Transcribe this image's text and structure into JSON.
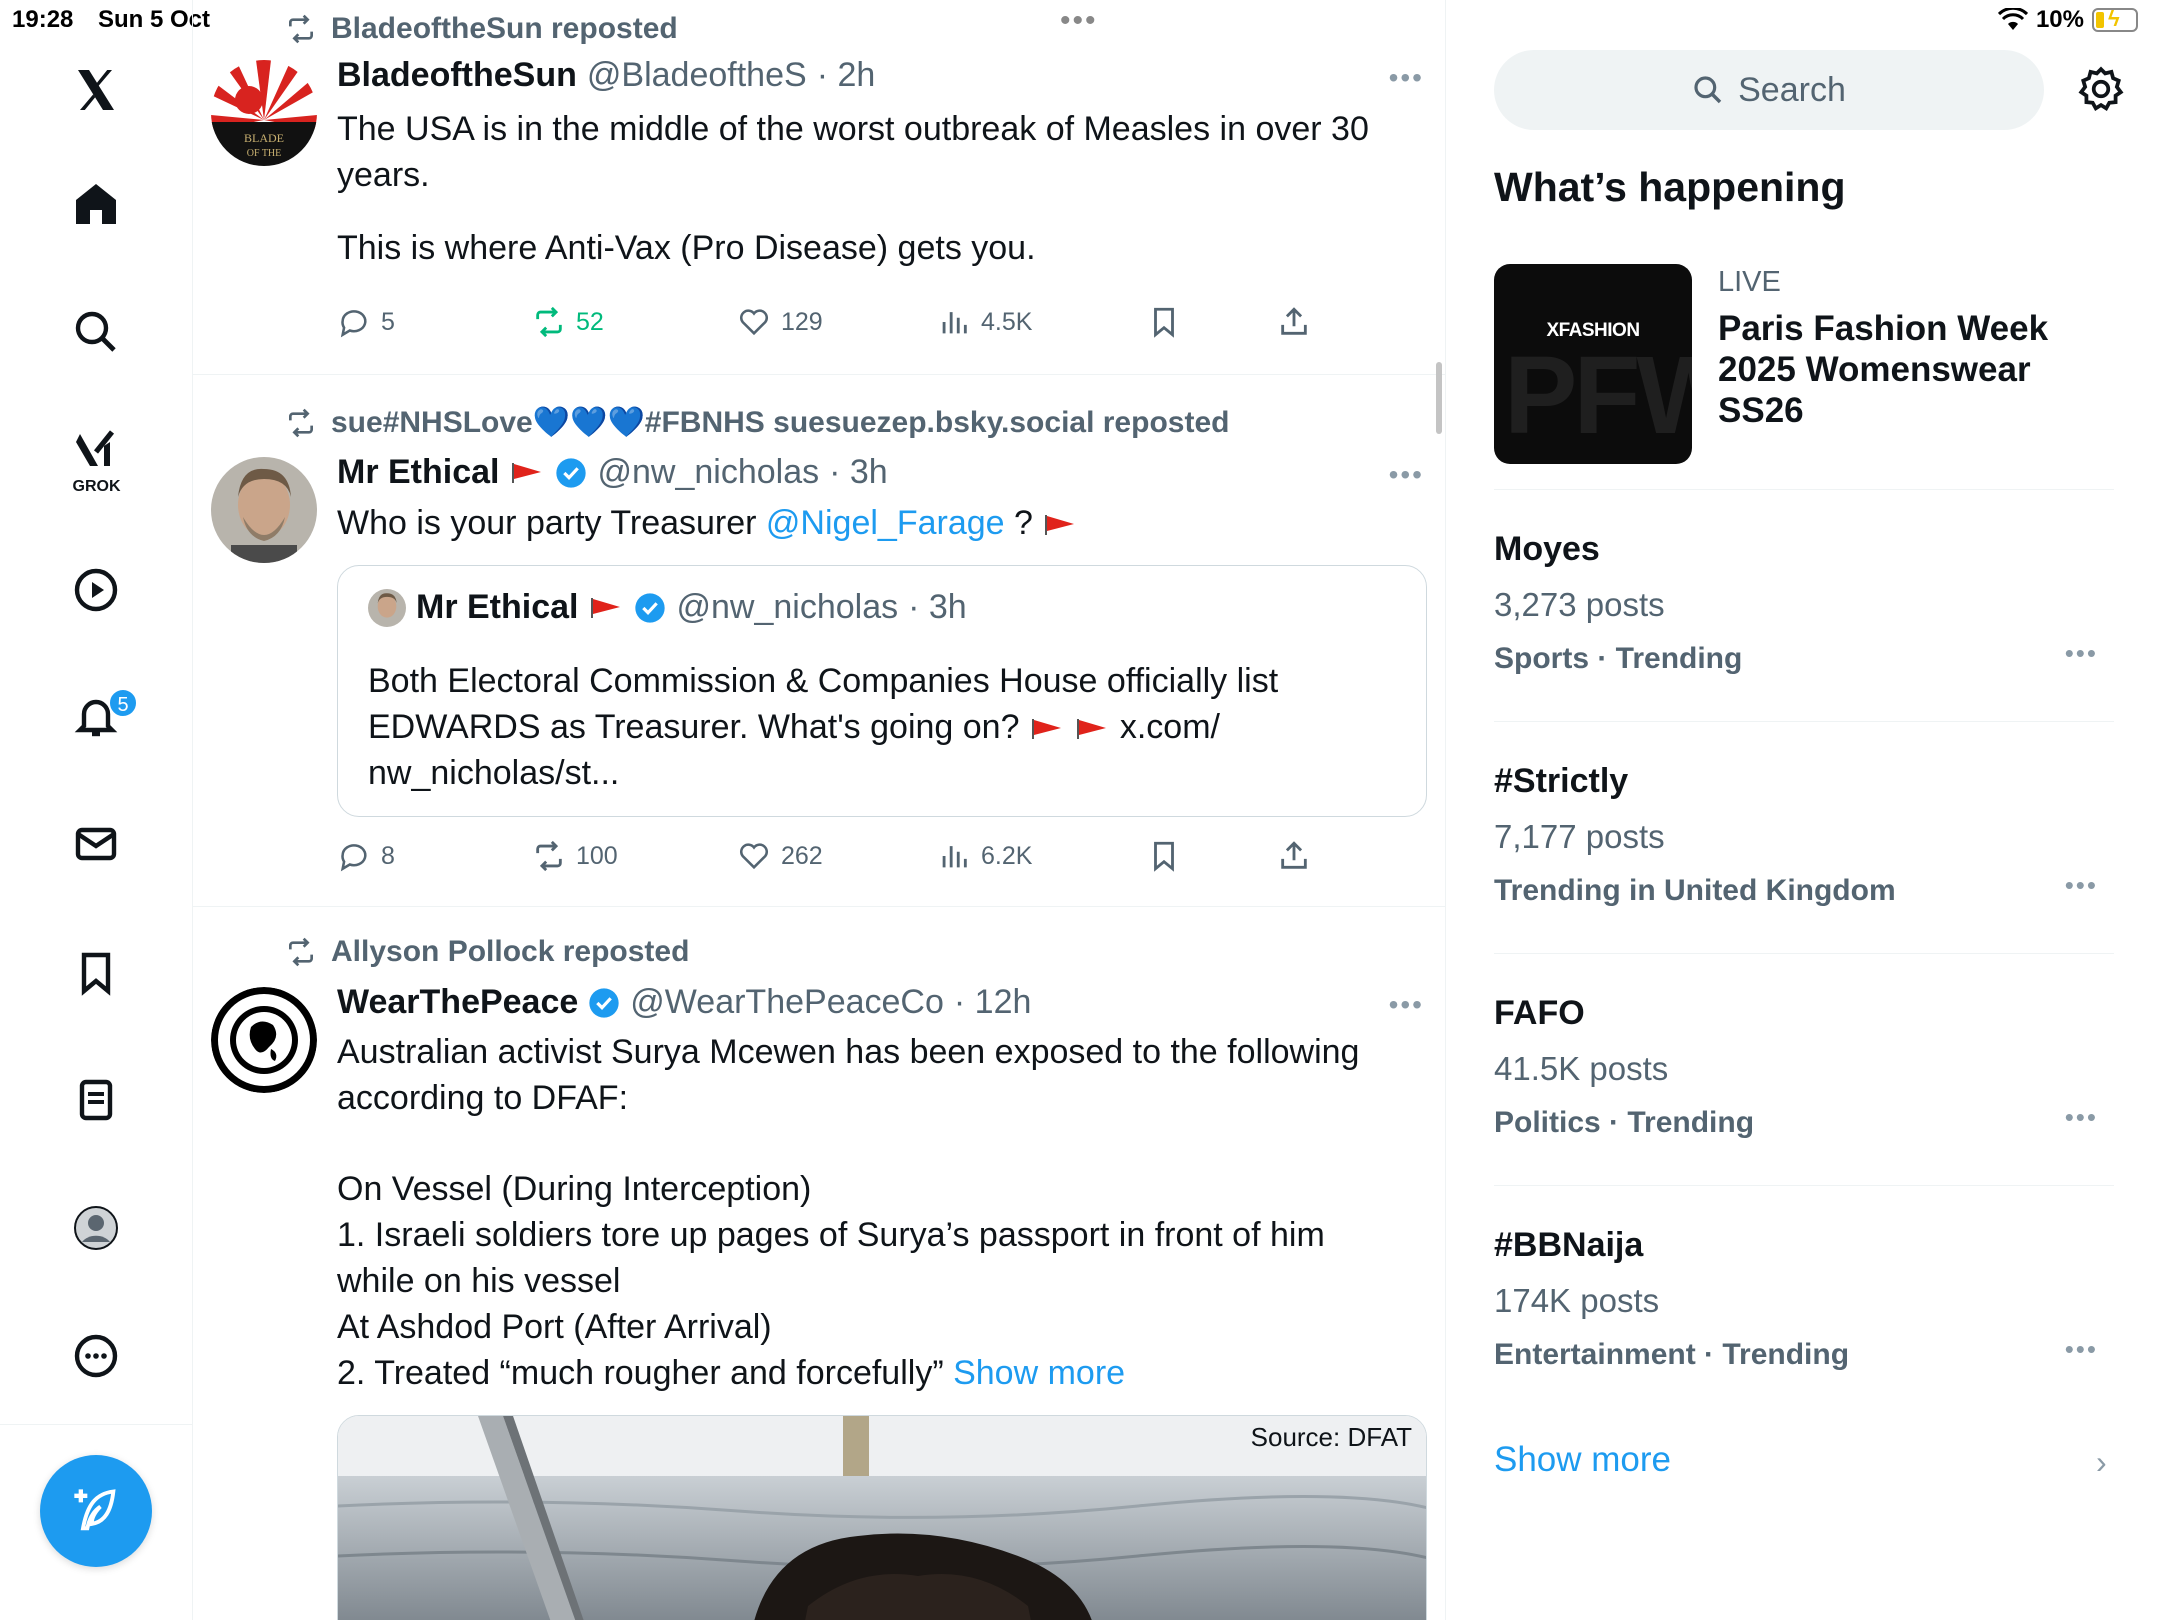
{
  "status": {
    "time": "19:28",
    "date": "Sun 5 Oct",
    "battery": "10%"
  },
  "nav": {
    "grok_label": "GROK",
    "notifications_badge": "5"
  },
  "tweets": [
    {
      "repost_by": "BladeoftheSun reposted",
      "name": "BladeoftheSun",
      "handle": "@BladeoftheS",
      "time": "· 2h",
      "text1": "The USA is in the middle of the worst outbreak of Measles in over 30 years.",
      "text2": "This is where Anti-Vax (Pro Disease) gets you.",
      "replies": "5",
      "reposts": "52",
      "likes": "129",
      "views": "4.5K"
    },
    {
      "repost_by": "sue#NHSLove💙💙💙#FBNHS suesuezep.bsky.social reposted",
      "name": "Mr Ethical",
      "handle": "@nw_nicholas",
      "time": "· 3h",
      "text_pre": "Who is your party Treasurer ",
      "mention": "@Nigel_Farage",
      "text_post": " ? ",
      "quote": {
        "name": "Mr Ethical",
        "handle": "@nw_nicholas",
        "time": "· 3h",
        "text_pre": "Both Electoral Commission & Companies House officially list EDWARDS as Treasurer. What's going on? ",
        "text_post": " x.com/ nw_nicholas/st..."
      },
      "replies": "8",
      "reposts": "100",
      "likes": "262",
      "views": "6.2K"
    },
    {
      "repost_by": "Allyson Pollock reposted",
      "name": "WearThePeace",
      "handle": "@WearThePeaceCo",
      "time": "· 12h",
      "line1": "Australian activist Surya Mcewen has been exposed to the following according to DFAF:",
      "line2": "On Vessel (During Interception)",
      "line3": "1. Israeli soldiers tore up pages of Surya’s passport in front of him while on his vessel",
      "line4": "At Ashdod Port (After Arrival)",
      "line5": "2. Treated “much rougher and forcefully” ",
      "show_more": "Show more",
      "media_source": "Source: DFAT"
    }
  ],
  "right": {
    "search_placeholder": "Search",
    "title": "What’s happening",
    "live": {
      "label": "LIVE",
      "title": "Paris Fashion Week 2025 Womenswear SS26",
      "thumb_brand": "XFASHION",
      "thumb_text": "PFW"
    },
    "trends": [
      {
        "name": "Moyes",
        "count": "3,273 posts",
        "category": "Sports · Trending"
      },
      {
        "name": "#Strictly",
        "count": "7,177 posts",
        "category": "Trending in United Kingdom"
      },
      {
        "name": "FAFO",
        "count": "41.5K posts",
        "category": "Politics · Trending"
      },
      {
        "name": "#BBNaija",
        "count": "174K posts",
        "category": "Entertainment · Trending"
      }
    ],
    "show_more": "Show more"
  },
  "colors": {
    "accent": "#1d9bf0",
    "repost_green": "#00ba7c",
    "secondary_text": "#536471"
  },
  "icons": [
    "x-logo-icon",
    "home-icon",
    "search-icon",
    "grok-icon",
    "video-icon",
    "bell-icon",
    "mail-icon",
    "bookmark-icon",
    "lists-icon",
    "profile-icon",
    "more-icon",
    "compose-icon",
    "settings-icon",
    "repost-icon",
    "reply-icon",
    "like-icon",
    "views-icon",
    "share-icon",
    "verified-icon",
    "red-flag-icon"
  ]
}
